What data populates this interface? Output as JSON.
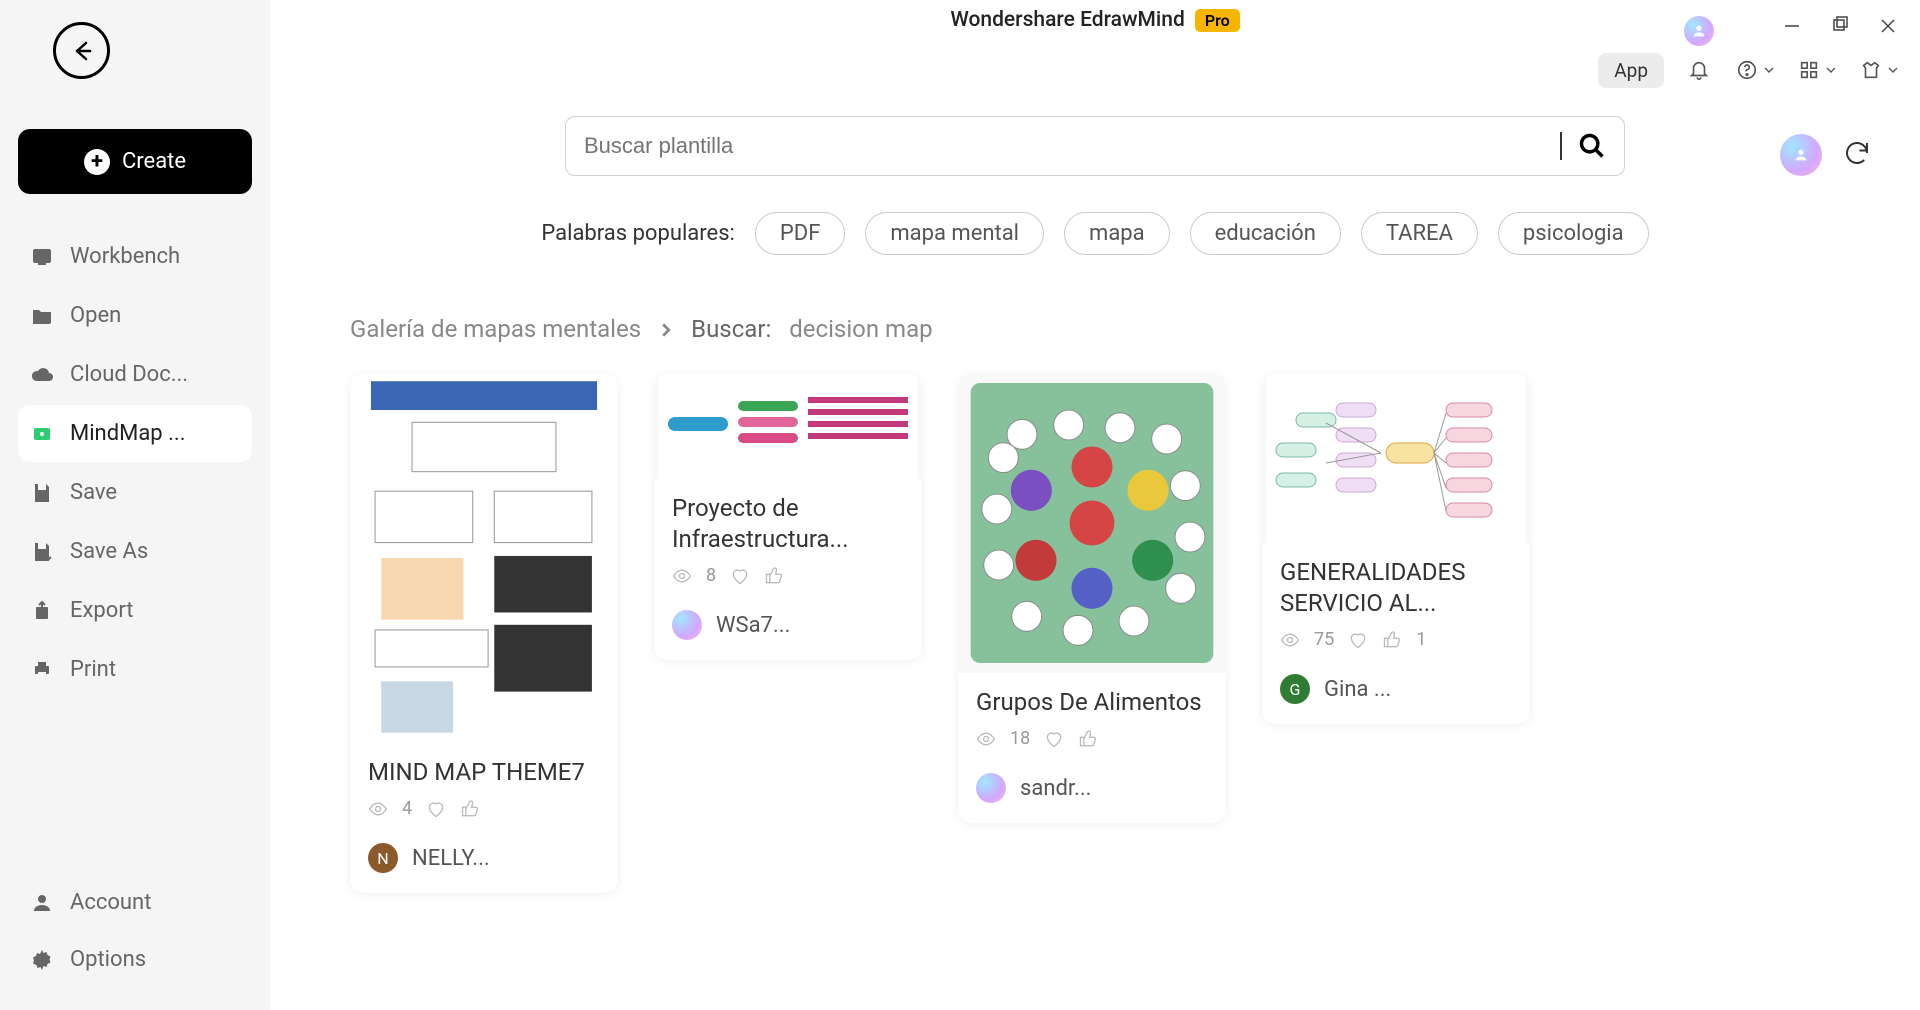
{
  "title": "Wondershare EdrawMind",
  "pro_label": "Pro",
  "toolbar": {
    "app_chip": "App"
  },
  "sidebar": {
    "create_label": "Create",
    "items": [
      {
        "label": "Workbench"
      },
      {
        "label": "Open"
      },
      {
        "label": "Cloud Doc..."
      },
      {
        "label": "MindMap ..."
      },
      {
        "label": "Save"
      },
      {
        "label": "Save As"
      },
      {
        "label": "Export"
      },
      {
        "label": "Print"
      }
    ],
    "bottom": [
      {
        "label": "Account"
      },
      {
        "label": "Options"
      }
    ]
  },
  "search": {
    "placeholder": "Buscar plantilla"
  },
  "tags": {
    "label": "Palabras populares:",
    "items": [
      "PDF",
      "mapa mental",
      "mapa",
      "educación",
      "TAREA",
      "psicologia"
    ]
  },
  "breadcrumb": {
    "root": "Galería de mapas mentales",
    "search_label": "Buscar:",
    "query": "decision map"
  },
  "cards": [
    {
      "title": "MIND MAP THEME7",
      "views": "4",
      "likes": "",
      "author": "NELLY...",
      "avatar_style": "av-n",
      "avatar_letter": "N"
    },
    {
      "title": "Proyecto de Infraestructura...",
      "views": "8",
      "likes": "",
      "author": "WSa7...",
      "avatar_style": "av-grad",
      "avatar_letter": ""
    },
    {
      "title": "Grupos De Alimentos",
      "views": "18",
      "likes": "",
      "author": "sandr...",
      "avatar_style": "av-grad",
      "avatar_letter": ""
    },
    {
      "title": "GENERALIDADES SERVICIO AL...",
      "views": "75",
      "likes": "1",
      "author": "Gina ...",
      "avatar_style": "av-g",
      "avatar_letter": "G"
    }
  ]
}
